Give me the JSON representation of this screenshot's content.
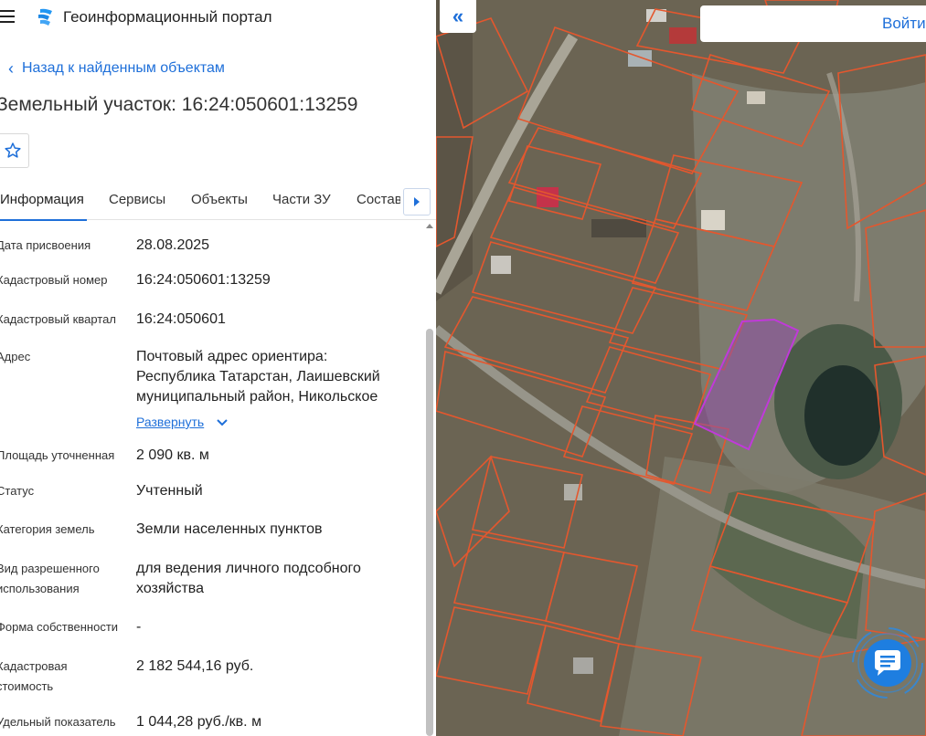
{
  "app": {
    "title": "Геоинформационный портал",
    "menu_icon": "hamburger-menu-icon",
    "logo_icon": "portal-logo-icon"
  },
  "nav": {
    "back_label": "Назад к найденным объектам"
  },
  "object": {
    "title": "Земельный участок: 16:24:050601:13259"
  },
  "tabs": [
    {
      "label": "Информация",
      "active": true
    },
    {
      "label": "Сервисы",
      "active": false
    },
    {
      "label": "Объекты",
      "active": false
    },
    {
      "label": "Части ЗУ",
      "active": false
    },
    {
      "label": "Состав",
      "active": false
    }
  ],
  "info": [
    {
      "label": "Дата присвоения",
      "value": "28.08.2025"
    },
    {
      "label": "Кадастровый номер",
      "value": "16:24:050601:13259"
    },
    {
      "label": "Кадастровый квартал",
      "value": "16:24:050601"
    },
    {
      "label": "Адрес",
      "value": "Почтовый адрес ориентира: Республика Татарстан, Лаишевский муниципальный район, Никольское"
    },
    {
      "label": "Площадь уточненная",
      "value": "2 090 кв. м"
    },
    {
      "label": "Статус",
      "value": "Учтенный"
    },
    {
      "label": "Категория земель",
      "value": "Земли населенных пунктов"
    },
    {
      "label": "Вид разрешенного использования",
      "value": "для ведения личного подсобного хозяйства"
    },
    {
      "label": "Форма собственности",
      "value": "-"
    },
    {
      "label": "Кадастровая стоимость",
      "value": "2 182 544,16 руб."
    },
    {
      "label": "Удельный показатель",
      "value": "1 044,28 руб./кв. м"
    }
  ],
  "expand_label": "Развернуть",
  "map": {
    "collapse_icon": "double-chevron-left-icon",
    "login_label": "Войти",
    "chat_icon": "chat-bubble-icon",
    "parcel_border_color": "#e4572e",
    "selected_parcel_color": "#c03ad9"
  }
}
